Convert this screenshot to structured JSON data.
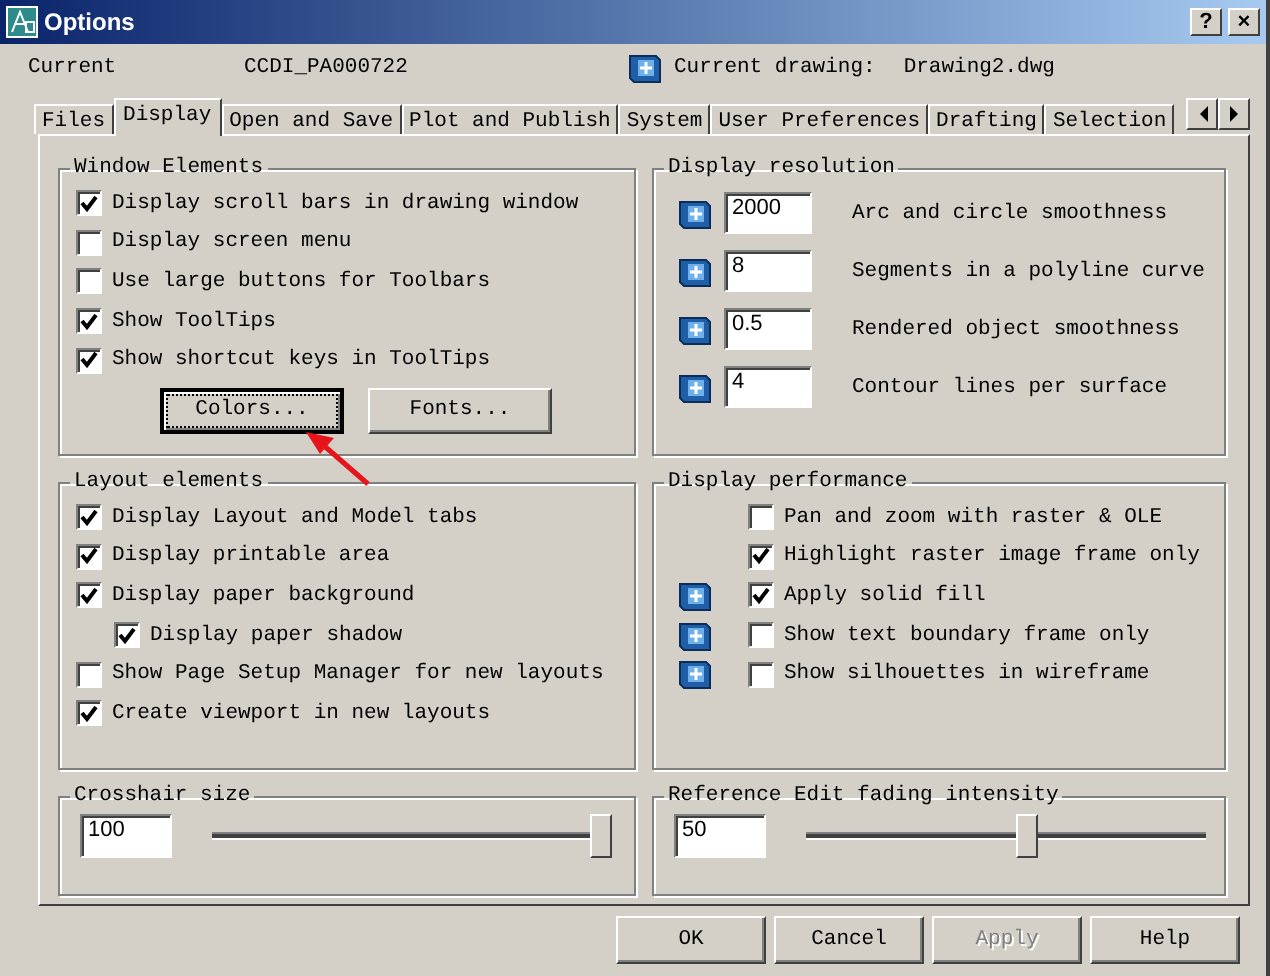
{
  "window": {
    "title": "Options",
    "title_buttons": [
      "?",
      "×"
    ]
  },
  "header": {
    "profile_label": "Current",
    "profile": "CCDI_PA000722",
    "drawing_label": "Current drawing:",
    "drawing": "Drawing2.dwg"
  },
  "tabs": [
    {
      "label": "Files",
      "selected": false
    },
    {
      "label": "Display",
      "selected": true
    },
    {
      "label": "Open and Save",
      "selected": false
    },
    {
      "label": "Plot and Publish",
      "selected": false
    },
    {
      "label": "System",
      "selected": false
    },
    {
      "label": "User Preferences",
      "selected": false
    },
    {
      "label": "Drafting",
      "selected": false
    },
    {
      "label": "Selection",
      "selected": false
    }
  ],
  "window_elements": {
    "title": "Window Elements",
    "options": [
      {
        "label": "Display scroll bars in drawing window",
        "checked": true
      },
      {
        "label": "Display screen menu",
        "checked": false
      },
      {
        "label": "Use large buttons for Toolbars",
        "checked": false
      },
      {
        "label": "Show ToolTips",
        "checked": true
      },
      {
        "label": "Show shortcut keys in ToolTips",
        "checked": true
      }
    ],
    "buttons": [
      {
        "label": "Colors...",
        "focused": true
      },
      {
        "label": "Fonts...",
        "focused": false
      }
    ]
  },
  "display_resolution": {
    "title": "Display resolution",
    "rows": [
      {
        "value": "2000",
        "label": "Arc and circle smoothness"
      },
      {
        "value": "8",
        "label": "Segments in a polyline curve"
      },
      {
        "value": "0.5",
        "label": "Rendered object smoothness"
      },
      {
        "value": "4",
        "label": "Contour lines per surface"
      }
    ]
  },
  "layout_elements": {
    "title": "Layout elements",
    "options": [
      {
        "label": "Display Layout and Model tabs",
        "checked": true
      },
      {
        "label": "Display printable area",
        "checked": true
      },
      {
        "label": "Display paper background",
        "checked": true,
        "children": [
          {
            "label": "Display paper shadow",
            "checked": true
          }
        ]
      },
      {
        "label": "Show Page Setup Manager for new layouts",
        "checked": false
      },
      {
        "label": "Create viewport in new layouts",
        "checked": true
      }
    ]
  },
  "display_performance": {
    "title": "Display performance",
    "options": [
      {
        "label": "Pan and zoom with raster & OLE",
        "checked": false,
        "saved_in_drawing": false
      },
      {
        "label": "Highlight raster image frame only",
        "checked": true,
        "saved_in_drawing": false
      },
      {
        "label": "Apply solid fill",
        "checked": true,
        "saved_in_drawing": true
      },
      {
        "label": "Show text boundary frame only",
        "checked": false,
        "saved_in_drawing": true
      },
      {
        "label": "Show silhouettes in wireframe",
        "checked": false,
        "saved_in_drawing": true
      }
    ]
  },
  "sliders": [
    {
      "title": "Crosshair size",
      "value": "100",
      "level": 1
    },
    {
      "title": "Reference Edit fading intensity",
      "value": "50",
      "level": 0.58
    }
  ],
  "buttons": [
    {
      "label": "OK",
      "disabled": false
    },
    {
      "label": "Cancel",
      "disabled": false
    },
    {
      "label": "Apply",
      "disabled": true
    },
    {
      "label": "Help",
      "disabled": false
    }
  ]
}
